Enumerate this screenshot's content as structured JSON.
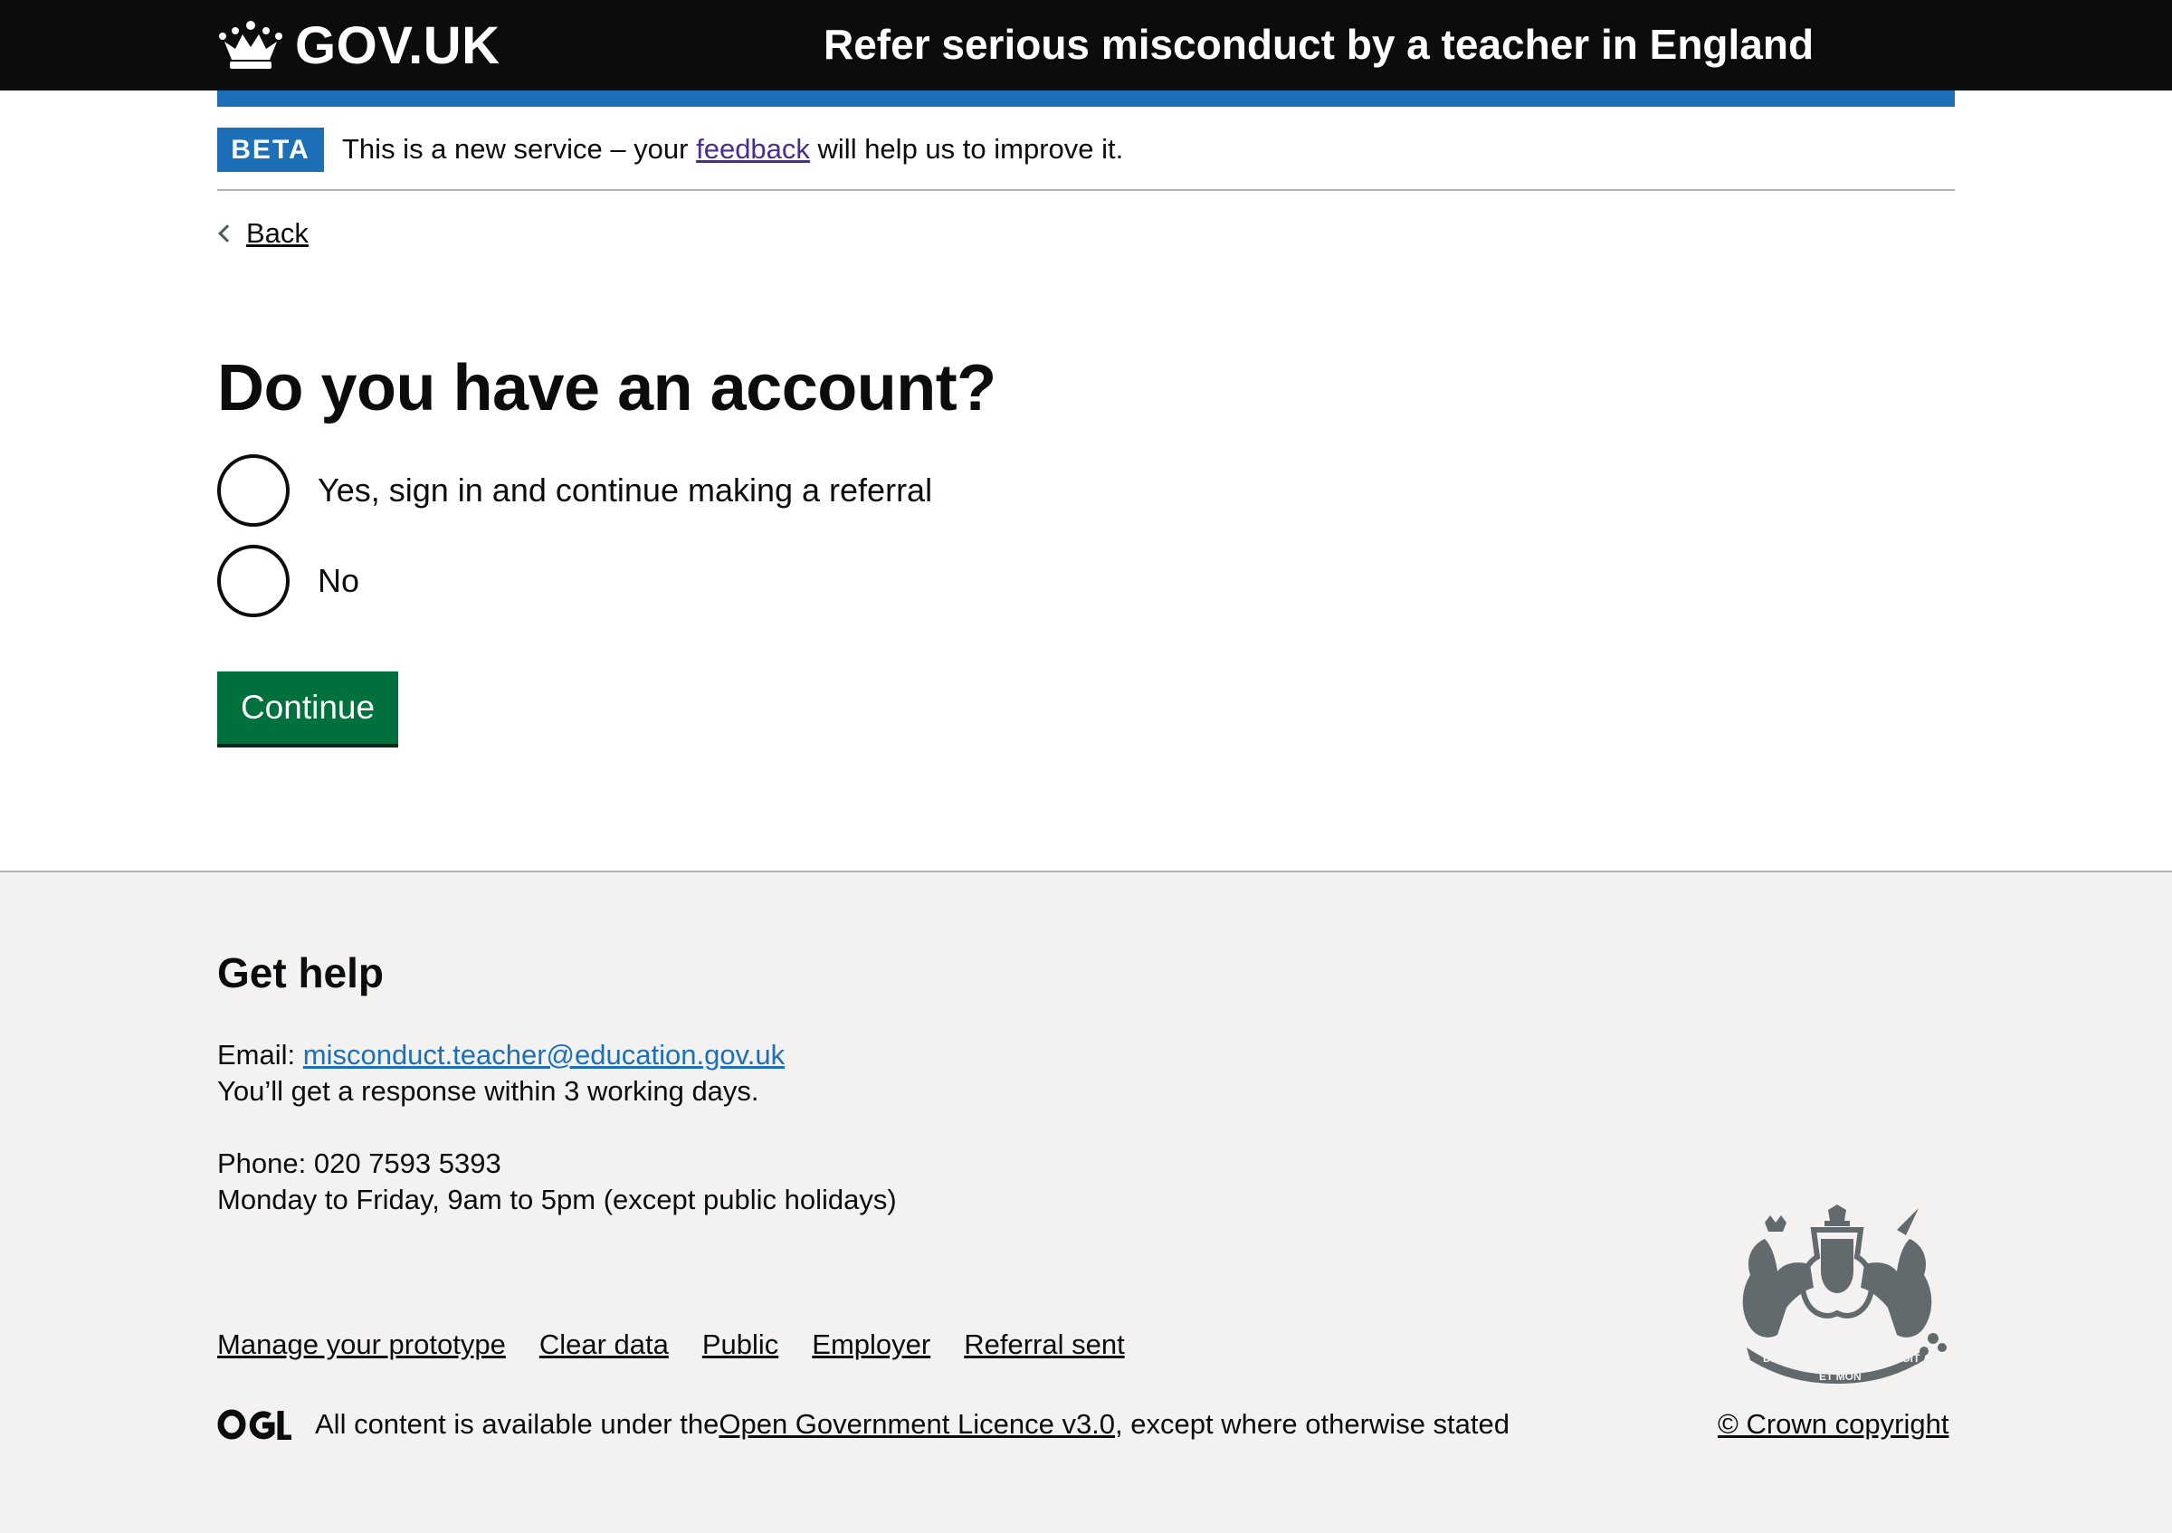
{
  "header": {
    "logo_text": "GOV.UK",
    "service_name": "Refer serious misconduct by a teacher in England"
  },
  "phase_banner": {
    "tag": "BETA",
    "text_before": "This is a new service – your ",
    "link": "feedback",
    "text_after": " will help us to improve it."
  },
  "back_link": "Back",
  "main": {
    "title": "Do you have an account?",
    "options": [
      {
        "label": "Yes, sign in and continue making a referral",
        "selected": false
      },
      {
        "label": "No",
        "selected": false
      }
    ],
    "continue_label": "Continue"
  },
  "footer": {
    "help_title": "Get help",
    "email_label": "Email: ",
    "email": "misconduct.teacher@education.gov.uk",
    "response_time": "You’ll get a response within 3 working days.",
    "phone": "Phone: 020 7593 5393",
    "hours": "Monday to Friday, 9am to 5pm (except public holidays)",
    "links": [
      "Manage your prototype",
      "Clear data",
      "Public",
      "Employer",
      "Referral sent"
    ],
    "licence_before": "All content is available under the ",
    "licence_link": "Open Government Licence v3.0",
    "licence_after": ", except where otherwise stated",
    "copyright": "© Crown copyright",
    "crest_motto": [
      "DIEU",
      "ET MON",
      "DROIT"
    ]
  },
  "colors": {
    "header_bg": "#0b0c0c",
    "accent_blue": "#1d70b8",
    "button_green": "#00703c",
    "footer_bg": "#f3f2f1",
    "visited_link": "#4c2c92"
  }
}
